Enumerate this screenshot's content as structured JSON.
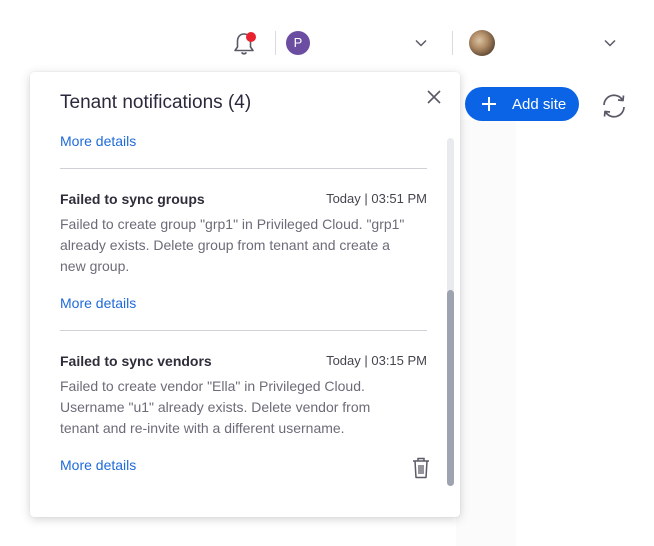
{
  "topbar": {
    "user_initial": "P"
  },
  "actions": {
    "add_site_label": "Add site"
  },
  "popover": {
    "title": "Tenant notifications (4)",
    "notifications": [
      {
        "more_label": "More details"
      },
      {
        "title": "Failed to sync groups",
        "time": "Today | 03:51 PM",
        "body": "Failed to create group \"grp1\" in Privileged Cloud. \"grp1\" already exists. Delete group from tenant and create a new group.",
        "more_label": "More details"
      },
      {
        "title": "Failed to sync vendors",
        "time": "Today | 03:15 PM",
        "body": "Failed to create vendor \"Ella\" in Privileged Cloud. Username \"u1\" already exists. Delete vendor from tenant and re-invite with a different username.",
        "more_label": "More details"
      }
    ]
  },
  "colors": {
    "accent": "#0b63e6",
    "link": "#1f6ad9",
    "alert_dot": "#e8232f",
    "avatar": "#6b4ea1"
  },
  "icons": [
    "bell-icon",
    "chevron-down-icon",
    "plus-icon",
    "refresh-icon",
    "close-icon",
    "trash-icon"
  ]
}
